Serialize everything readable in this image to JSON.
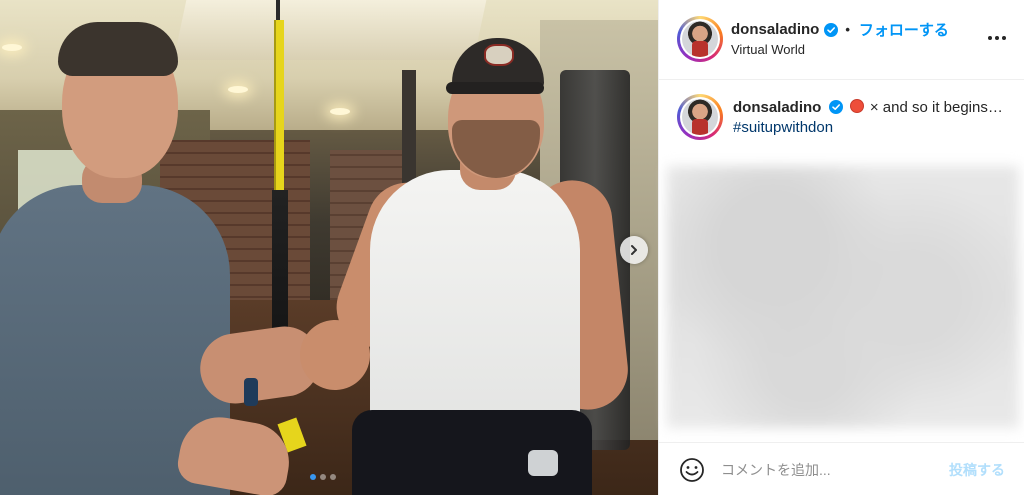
{
  "post": {
    "username": "donsaladino",
    "follow_separator": "•",
    "follow_label": "フォローする",
    "location": "Virtual World",
    "more_icon": "more-horizontal-icon",
    "verified_icon": "verified-badge-icon",
    "caption": {
      "username": "donsaladino",
      "text_before_emoji": "",
      "text_after_emoji": " × and so it begins…",
      "hashtag": "#suitupwithdon"
    },
    "carousel": {
      "total_slides": 3,
      "active_slide": 1,
      "next_icon": "chevron-right-icon"
    }
  },
  "comment": {
    "placeholder": "コメントを追加...",
    "post_label": "投稿する",
    "emoji_icon": "smiley-icon"
  },
  "colors": {
    "accent": "#0095f6",
    "post_disabled": "#b2dffc",
    "hashtag": "#00376b"
  }
}
